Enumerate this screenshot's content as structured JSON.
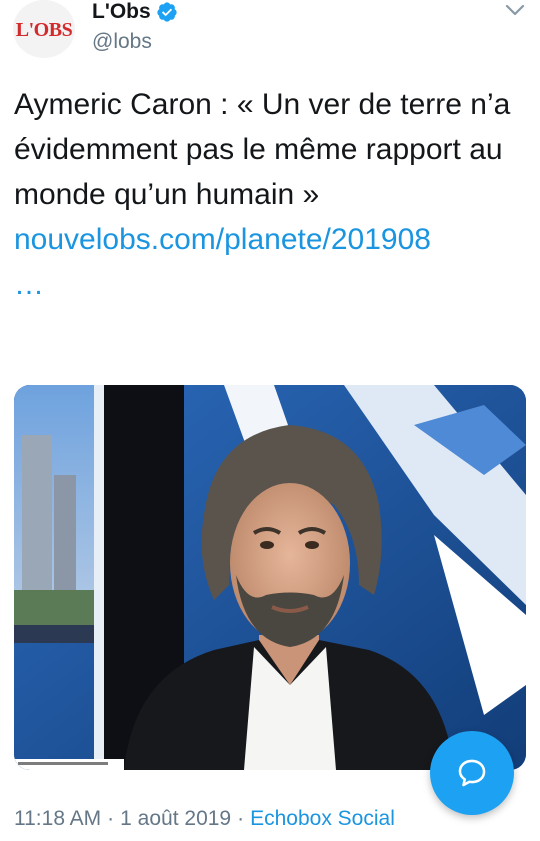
{
  "account": {
    "avatar_text": "L'OBS",
    "display_name": "L'Obs",
    "handle": "@lobs"
  },
  "tweet": {
    "text": "Aymeric Caron : « Un ver de terre n’a évidemment pas le même rapport au monde qu’un humain »",
    "link": "nouvelobs.com/planete/201908",
    "link_ellipsis": "…"
  },
  "meta": {
    "time": "11:18 AM",
    "separator": "·",
    "date": "1 août 2019",
    "source": "Echobox Social"
  },
  "colors": {
    "link": "#1b95e0",
    "fab": "#1da1f2",
    "secondary_text": "#657786",
    "brand_red": "#d32b2b"
  },
  "icons": {
    "verified": "verified-badge-icon",
    "menu": "chevron-down-icon",
    "compose": "reply-bubble-icon"
  }
}
